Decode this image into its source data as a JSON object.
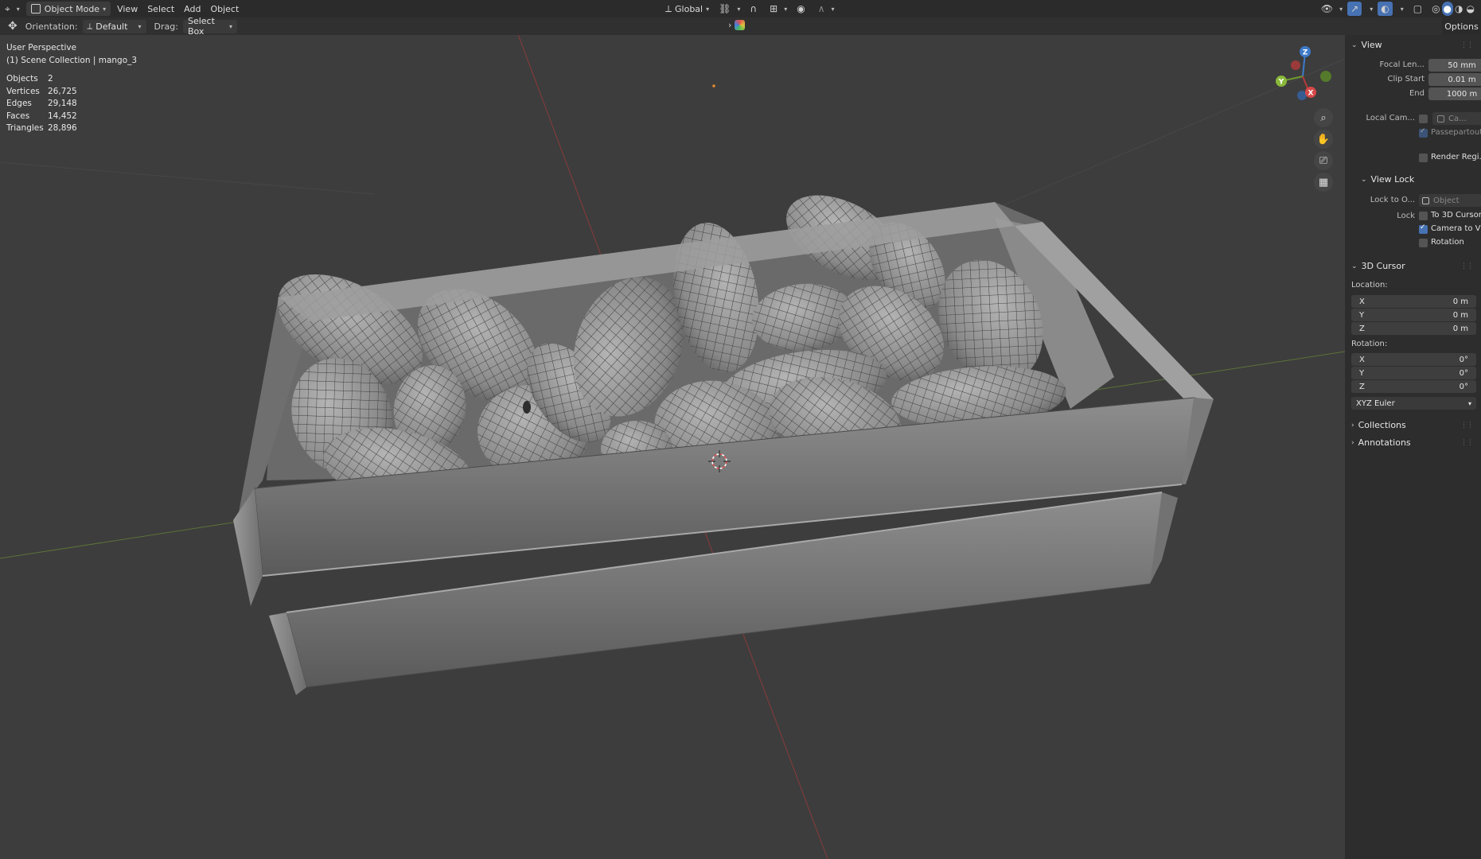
{
  "header": {
    "mode": "Object Mode",
    "menus": [
      "View",
      "Select",
      "Add",
      "Object"
    ],
    "transform_orientation": "Global",
    "options_tab": "Options"
  },
  "toolbar": {
    "orientation_label": "Orientation:",
    "orientation_value": "Default",
    "drag_label": "Drag:",
    "drag_value": "Select Box"
  },
  "viewport": {
    "perspective": "User Perspective",
    "collection": "(1) Scene Collection | mango_3",
    "stats": [
      {
        "key": "Objects",
        "value": "2"
      },
      {
        "key": "Vertices",
        "value": "26,725"
      },
      {
        "key": "Edges",
        "value": "29,148"
      },
      {
        "key": "Faces",
        "value": "14,452"
      },
      {
        "key": "Triangles",
        "value": "28,896"
      }
    ],
    "gizmo_axes": {
      "x": "X",
      "y": "Y",
      "z": "Z"
    }
  },
  "sidebar": {
    "view": {
      "title": "View",
      "focal_length_label": "Focal Len...",
      "focal_length_value": "50 mm",
      "clip_start_label": "Clip Start",
      "clip_start_value": "0.01 m",
      "end_label": "End",
      "end_value": "1000 m",
      "local_camera_label": "Local Cam...",
      "local_camera_value": "Ca...",
      "passepartout_label": "Passepartout",
      "render_region_label": "Render Regi..."
    },
    "view_lock": {
      "title": "View Lock",
      "lock_to_label": "Lock to O...",
      "lock_to_placeholder": "Object",
      "lock_label": "Lock",
      "to_3d_cursor_label": "To 3D Cursor",
      "camera_to_view_label": "Camera to Vi...",
      "rotation_label": "Rotation"
    },
    "cursor": {
      "title": "3D Cursor",
      "location_label": "Location:",
      "location": [
        {
          "axis": "X",
          "value": "0 m"
        },
        {
          "axis": "Y",
          "value": "0 m"
        },
        {
          "axis": "Z",
          "value": "0 m"
        }
      ],
      "rotation_label": "Rotation:",
      "rotation": [
        {
          "axis": "X",
          "value": "0°"
        },
        {
          "axis": "Y",
          "value": "0°"
        },
        {
          "axis": "Z",
          "value": "0°"
        }
      ],
      "rotation_mode": "XYZ Euler"
    },
    "collections_title": "Collections",
    "annotations_title": "Annotations"
  }
}
